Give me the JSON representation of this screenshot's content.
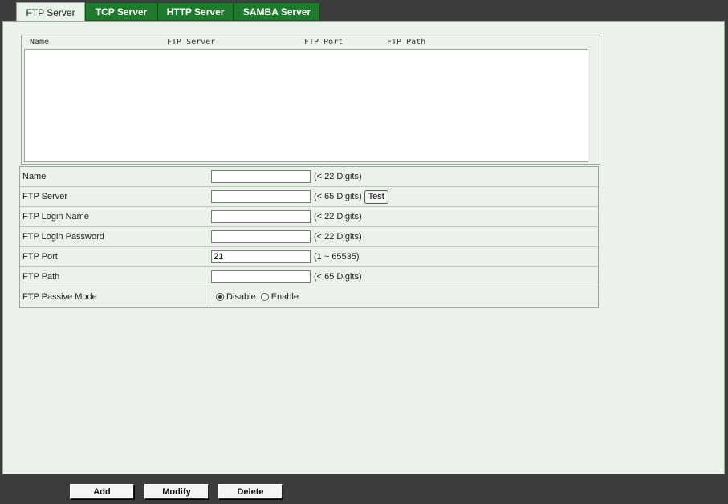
{
  "tabs": [
    {
      "label": "FTP Server",
      "active": true
    },
    {
      "label": "TCP Server",
      "active": false
    },
    {
      "label": "HTTP Server",
      "active": false
    },
    {
      "label": "SAMBA Server",
      "active": false
    }
  ],
  "list": {
    "columns": [
      "Name",
      "FTP Server",
      "FTP Port",
      "FTP Path"
    ],
    "rows": []
  },
  "form": {
    "name": {
      "label": "Name",
      "value": "",
      "hint": "(< 22 Digits)"
    },
    "server": {
      "label": "FTP Server",
      "value": "",
      "hint": "(< 65 Digits)",
      "test_label": "Test"
    },
    "login_name": {
      "label": "FTP Login Name",
      "value": "",
      "hint": "(< 22 Digits)"
    },
    "login_password": {
      "label": "FTP Login Password",
      "value": "",
      "hint": "(< 22 Digits)"
    },
    "port": {
      "label": "FTP Port",
      "value": "21",
      "hint": "(1 ~ 65535)"
    },
    "path": {
      "label": "FTP Path",
      "value": "",
      "hint": "(< 65 Digits)"
    },
    "passive_mode": {
      "label": "FTP Passive Mode",
      "options": [
        "Disable",
        "Enable"
      ],
      "selected": "Disable"
    }
  },
  "buttons": {
    "add": "Add",
    "modify": "Modify",
    "delete": "Delete"
  },
  "colors": {
    "tab_green": "#1f7a2e",
    "panel_bg": "#eaf2ea",
    "page_bg": "#3c3c3c"
  }
}
